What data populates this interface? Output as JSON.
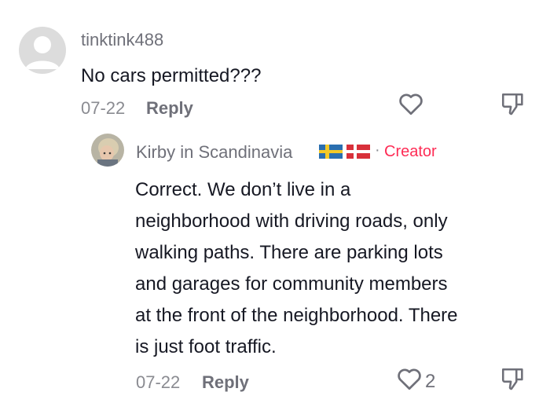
{
  "comment": {
    "username": "tinktink488",
    "text": "No cars permitted???",
    "date": "07-22",
    "reply_label": "Reply",
    "avatar_icon": "default-avatar-icon",
    "like_icon": "heart-outline-icon",
    "dislike_icon": "thumb-down-icon"
  },
  "reply": {
    "username": "Kirby in Scandinavia",
    "flags": [
      "sweden-flag",
      "denmark-flag"
    ],
    "separator": "·",
    "badge": "Creator",
    "lines": [
      "Correct. We don’t live in a",
      "neighborhood with driving roads, only",
      "walking paths. There are parking lots",
      "and garages for community members",
      "at the front of the neighborhood. There",
      "is just foot traffic."
    ],
    "date": "07-22",
    "reply_label": "Reply",
    "like_count": "2",
    "like_icon": "heart-outline-icon",
    "dislike_icon": "thumb-down-icon"
  },
  "colors": {
    "creator": "#fe2c55",
    "text": "#161823",
    "muted": "#8a8b91"
  }
}
